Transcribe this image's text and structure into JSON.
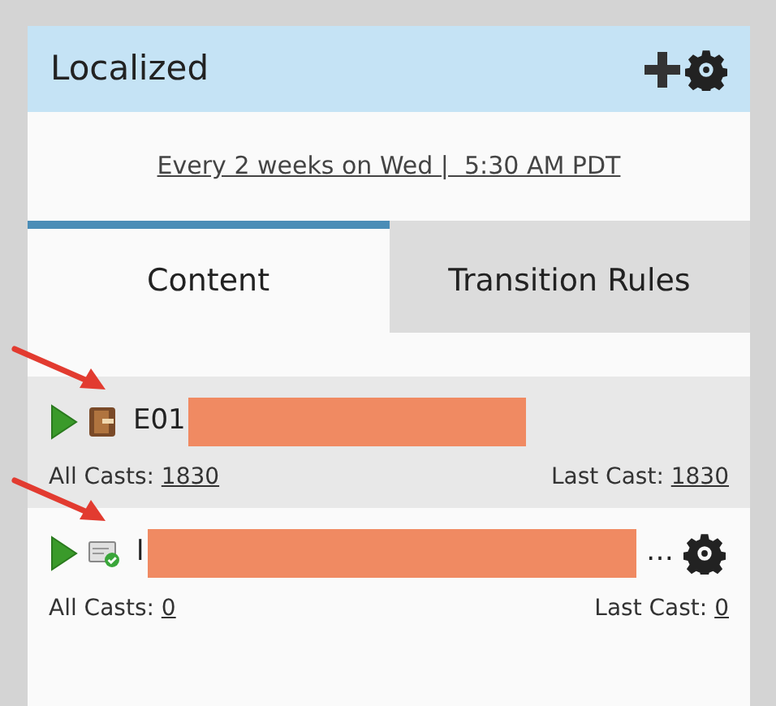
{
  "panel": {
    "title": "Localized",
    "schedule": "Every 2 weeks on Wed |  5:30 AM PDT"
  },
  "tabs": [
    {
      "label": "Content",
      "selected": true
    },
    {
      "label": "Transition Rules",
      "selected": false
    }
  ],
  "items": [
    {
      "kind": "email-program",
      "title": "E01",
      "redacted": true,
      "marked": true,
      "selected": true,
      "show_settings": false,
      "all_casts_label": "All Casts:",
      "all_casts": "1830",
      "last_cast_label": "Last Cast:",
      "last_cast": "1830"
    },
    {
      "kind": "approved-email",
      "title": "l",
      "redacted": true,
      "title_end": "…",
      "marked": true,
      "selected": false,
      "show_settings": true,
      "all_casts_label": "All Casts:",
      "all_casts": "0",
      "last_cast_label": "Last Cast:",
      "last_cast": "0"
    }
  ]
}
